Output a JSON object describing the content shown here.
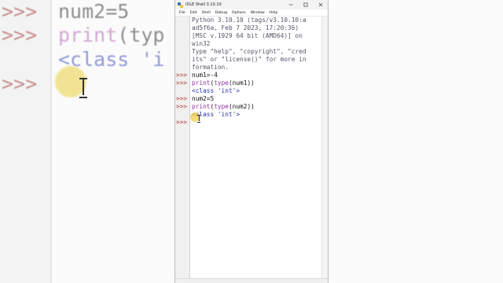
{
  "window": {
    "title": "IDLE Shell 3.10.10",
    "controls": [
      "minimize",
      "maximize",
      "close"
    ]
  },
  "menu": [
    "File",
    "Edit",
    "Shell",
    "Debug",
    "Options",
    "Window",
    "Help"
  ],
  "shell": {
    "prompt": ">>>",
    "banner": [
      "Python 3.10.10 (tags/v3.10.10:a",
      "ad5f6a, Feb  7 2023, 17:20:36)",
      "[MSC v.1929 64 bit (AMD64)] on",
      "win32",
      "Type \"help\", \"copyright\", \"cred",
      "its\" or \"license()\" for more in",
      "formation."
    ],
    "entries": [
      {
        "input": "num1=-4"
      },
      {
        "input_fn": "print",
        "input_mid": "(",
        "input_fn2": "type",
        "input_rest": "(num1))"
      },
      {
        "output": "<class 'int'>"
      },
      {
        "input": "num2=5"
      },
      {
        "input_fn": "print",
        "input_mid": "(",
        "input_fn2": "type",
        "input_rest": "(num2))"
      },
      {
        "output": "<class 'int'>"
      }
    ]
  },
  "background": {
    "prompt": ">>>",
    "line1": "num2=5",
    "line2_kw": "print",
    "line2_rest": "(typ",
    "line3": "<class 'i",
    "line4_prompt": ">>>"
  },
  "colors": {
    "prompt": "#b03030",
    "keyword": "#8e2ea0",
    "output": "#2431a8",
    "highlight": "#eece46"
  }
}
